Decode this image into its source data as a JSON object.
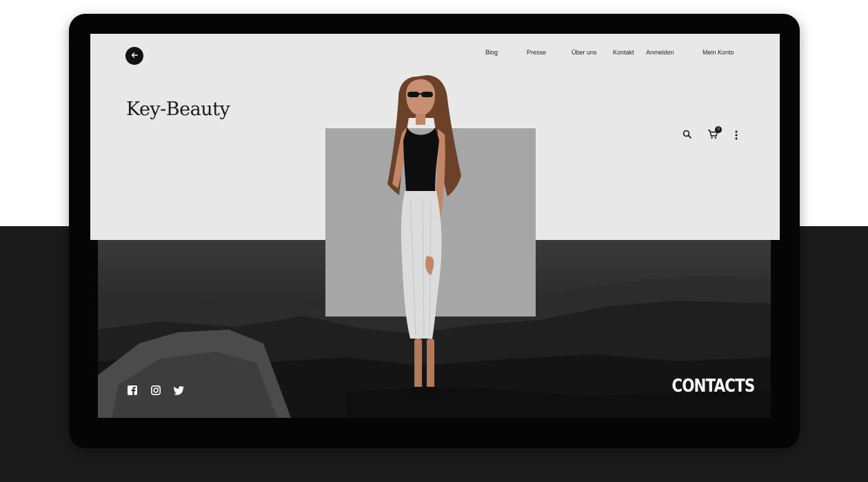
{
  "site": {
    "logo": "Key-Beauty"
  },
  "nav": {
    "items": [
      "Blog",
      "Presse",
      "Über uns",
      "Kontakt",
      "Anmelden",
      "Mein Konto"
    ]
  },
  "header": {
    "back_icon": "arrow-left-icon",
    "cart_count": "0"
  },
  "header_icons": [
    "search-icon",
    "cart-icon",
    "more-vertical-icon"
  ],
  "footer": {
    "social_icons": [
      "facebook-icon",
      "instagram-icon",
      "twitter-icon"
    ],
    "contacts_label": "CONTACTS"
  },
  "colors": {
    "panel": "#e8e8e8",
    "frame": "#050505",
    "accent_square": "#a6a6a6",
    "backdrop": "#1b1b1b"
  }
}
